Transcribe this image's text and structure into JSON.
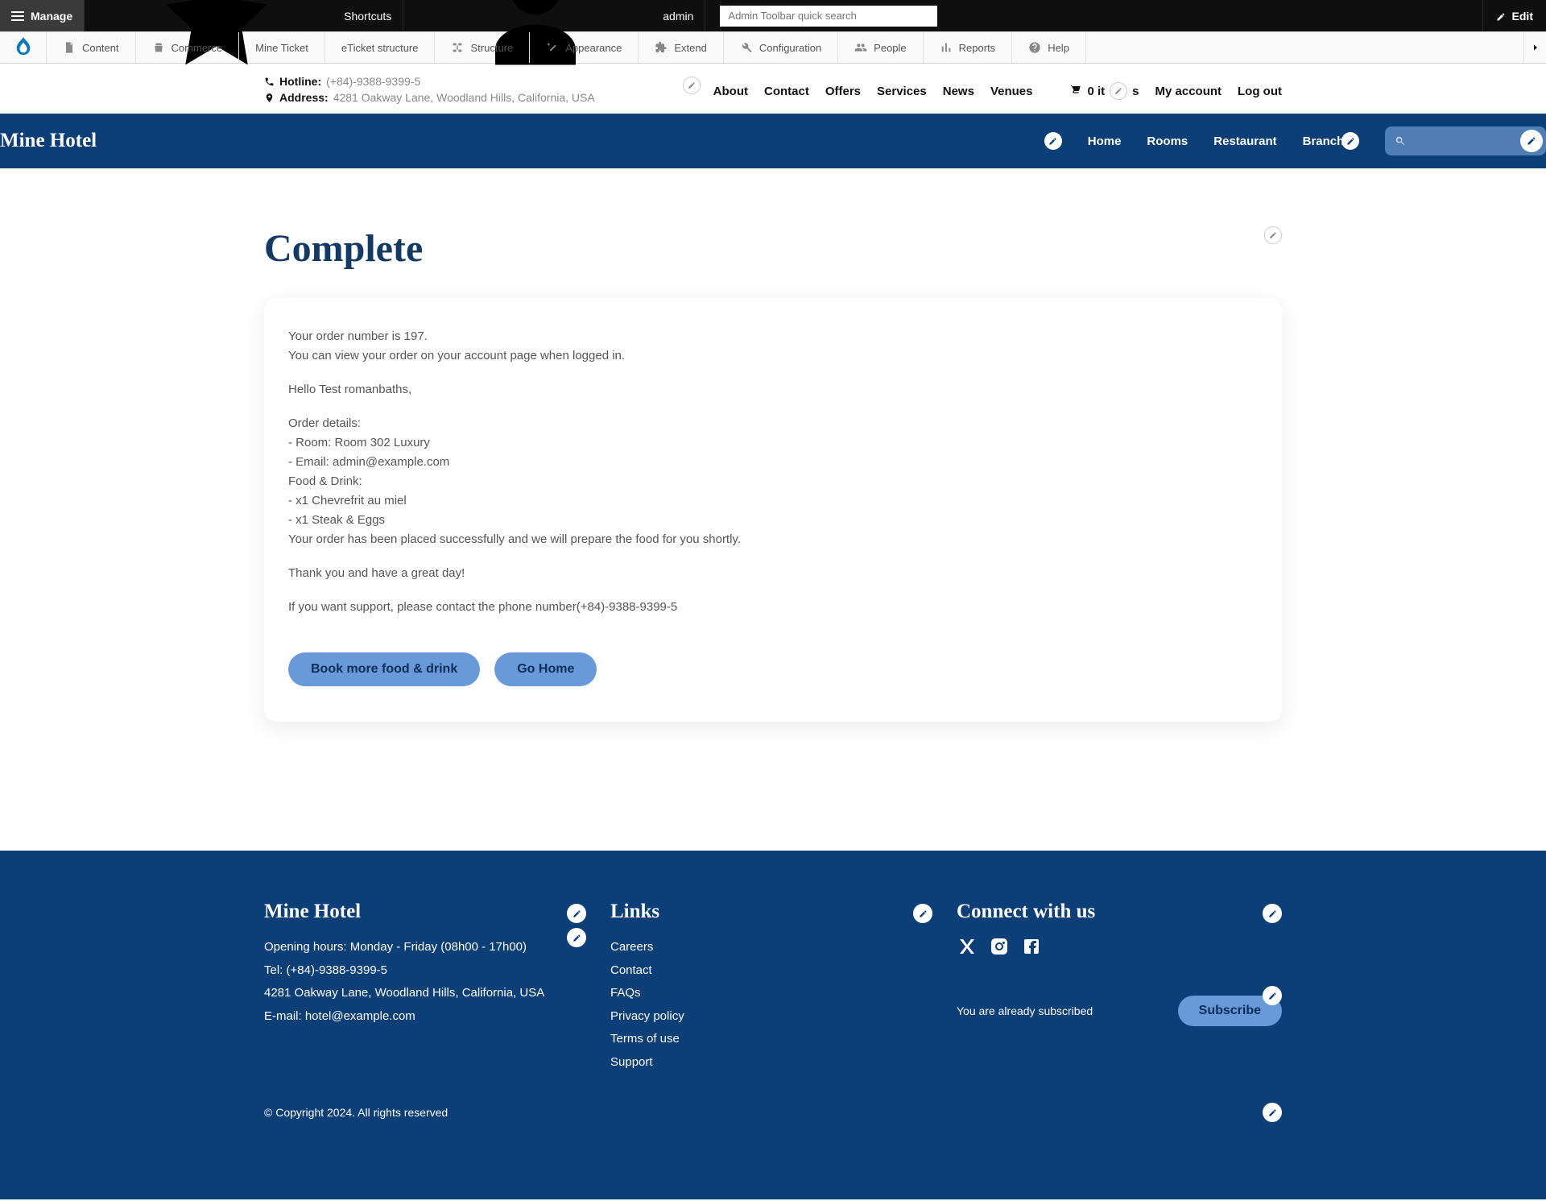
{
  "admin_toolbar": {
    "manage": "Manage",
    "shortcuts": "Shortcuts",
    "user": "admin",
    "search_placeholder": "Admin Toolbar quick search",
    "edit": "Edit"
  },
  "admin_menu": {
    "items": [
      {
        "icon": "file",
        "label": "Content"
      },
      {
        "icon": "cart",
        "label": "Commerce"
      },
      {
        "icon": "",
        "label": "Mine Ticket"
      },
      {
        "icon": "",
        "label": "eTicket structure"
      },
      {
        "icon": "hierarchy",
        "label": "Structure"
      },
      {
        "icon": "wand",
        "label": "Appearance"
      },
      {
        "icon": "puzzle",
        "label": "Extend"
      },
      {
        "icon": "wrench",
        "label": "Configuration"
      },
      {
        "icon": "people",
        "label": "People"
      },
      {
        "icon": "reports",
        "label": "Reports"
      },
      {
        "icon": "help",
        "label": "Help"
      }
    ]
  },
  "header": {
    "hotline_label": "Hotline:",
    "hotline_value": "(+84)-9388-9399-5",
    "address_label": "Address:",
    "address_value": "4281 Oakway Lane, Woodland Hills, California, USA",
    "nav": [
      "About",
      "Contact",
      "Offers",
      "Services",
      "News",
      "Venues"
    ],
    "cart_text": "0 it",
    "cart_text_after": "s",
    "account": "My account",
    "logout": "Log out"
  },
  "bluebar": {
    "brand": "Mine Hotel",
    "nav": [
      "Home",
      "Rooms",
      "Restaurant",
      "Branches"
    ]
  },
  "page": {
    "title": "Complete",
    "line_order_num": "Your order number is 197.",
    "line_view": "You can view your order on your account page when logged in.",
    "hello": "Hello Test romanbaths,",
    "details_heading": "Order details:",
    "room": "- Room: Room 302 Luxury",
    "email": "- Email: admin@example.com",
    "food_heading": "Food & Drink:",
    "food1": "- x1 Chevrefrit au miel",
    "food2": "- x1 Steak & Eggs",
    "placed": "Your order has been placed successfully and we will prepare the food for you shortly.",
    "thanks": "Thank you and have a great day!",
    "support": "If you want support, please contact the phone number(+84)-9388-9399-5",
    "btn_book": "Book more food & drink",
    "btn_home": "Go Home"
  },
  "footer": {
    "brand": "Mine Hotel",
    "hours": "Opening hours: Monday - Friday (08h00 - 17h00)",
    "tel": "Tel: (+84)-9388-9399-5",
    "addr": "4281 Oakway Lane, Woodland Hills, California, USA",
    "email": "E-mail: hotel@example.com",
    "links_heading": "Links",
    "links": [
      "Careers",
      "Contact",
      "FAQs",
      "Privacy policy",
      "Terms of use",
      "Support"
    ],
    "connect_heading": "Connect with us",
    "already": "You are already subscribed",
    "subscribe": "Subscribe",
    "copyright": "© Copyright 2024. All rights reserved"
  }
}
